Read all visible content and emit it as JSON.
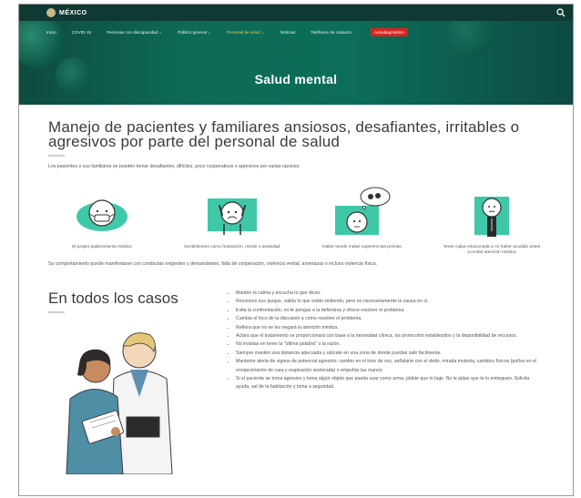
{
  "header": {
    "logo_text": "MÉXICO"
  },
  "nav": {
    "items": [
      {
        "label": "Inicio"
      },
      {
        "label": "COVID-19"
      },
      {
        "label": "Personas con discapacidad ⌄"
      },
      {
        "label": "Público general ⌄"
      },
      {
        "label": "Personal de salud ⌄"
      },
      {
        "label": "Noticias"
      },
      {
        "label": "Teléfonos de contacto"
      }
    ],
    "cta_label": "Autodiagnóstico"
  },
  "hero": {
    "title": "Salud mental"
  },
  "main": {
    "title": "Manejo de pacientes y familiares ansiosos, desafiantes, irritables o agresivos por parte del personal de salud",
    "intro": "Los pacientes o sus familiares se pueden tornar desafiantes, difíciles, poco cooperativos o agresivos por varias razones:",
    "factors": [
      {
        "caption": "El propio padecimiento médico"
      },
      {
        "caption": "Sentimientos como frustración, miedo o ansiedad"
      },
      {
        "caption": "Haber tenido malas experiencias previas"
      },
      {
        "caption": "Tener culpa relacionada a no haber acudido antes a recibir atención médica"
      }
    ],
    "behavior": "Su comportamiento puede manifestarse con conductas exigentes y demandantes, falta de cooperación, violencia verbal, amenazas o incluso violencia física."
  },
  "cases": {
    "title": "En todos los casos",
    "bullets": [
      "Mantén la calma y escucha lo que dicen.",
      "Reconoce sus quejas, valida lo que están sintiendo, pero no necesariamente la causa en sí.",
      "Evita la confrontación, no te pongas a la defensiva y ofrece resolver el problema.",
      "Cambia el foco de la discusión a cómo resolver el problema.",
      "Refiera que no se les negará la atención médica.",
      "Aclara que el tratamiento se proporcionará con base a la necesidad clínica, los protocolos establecidos y la disponibilidad de recursos.",
      "No insistas en tener la \"última palabra\" o la razón.",
      "Siempre mantén una distancia adecuada y ubícate en una zona de donde puedas salir fácilmente.",
      "Mantente alerta de signos de potencial agresión: cambio en el tono de voz, señalarte con el dedo, mirada molesta, cambios físicos (puños en el enrojecimiento de cara y respiración acelerada) o empuñar las manos.",
      "Si el paciente se torna agresivo y toma algún objeto que pueda usar como arma, pídele que lo baje. No le pidas que te lo entreguen. Solicita ayuda, sal de la habitación y toma a seguridad."
    ]
  },
  "colors": {
    "header_bg": "#0f3a33",
    "hero_bg": "#0d6a55",
    "accent_yellow": "#f0c84a",
    "cta_red": "#d8241f",
    "icon_teal": "#3fc8a8"
  },
  "icons": {
    "search": "search-icon",
    "seal": "government-seal-icon"
  }
}
